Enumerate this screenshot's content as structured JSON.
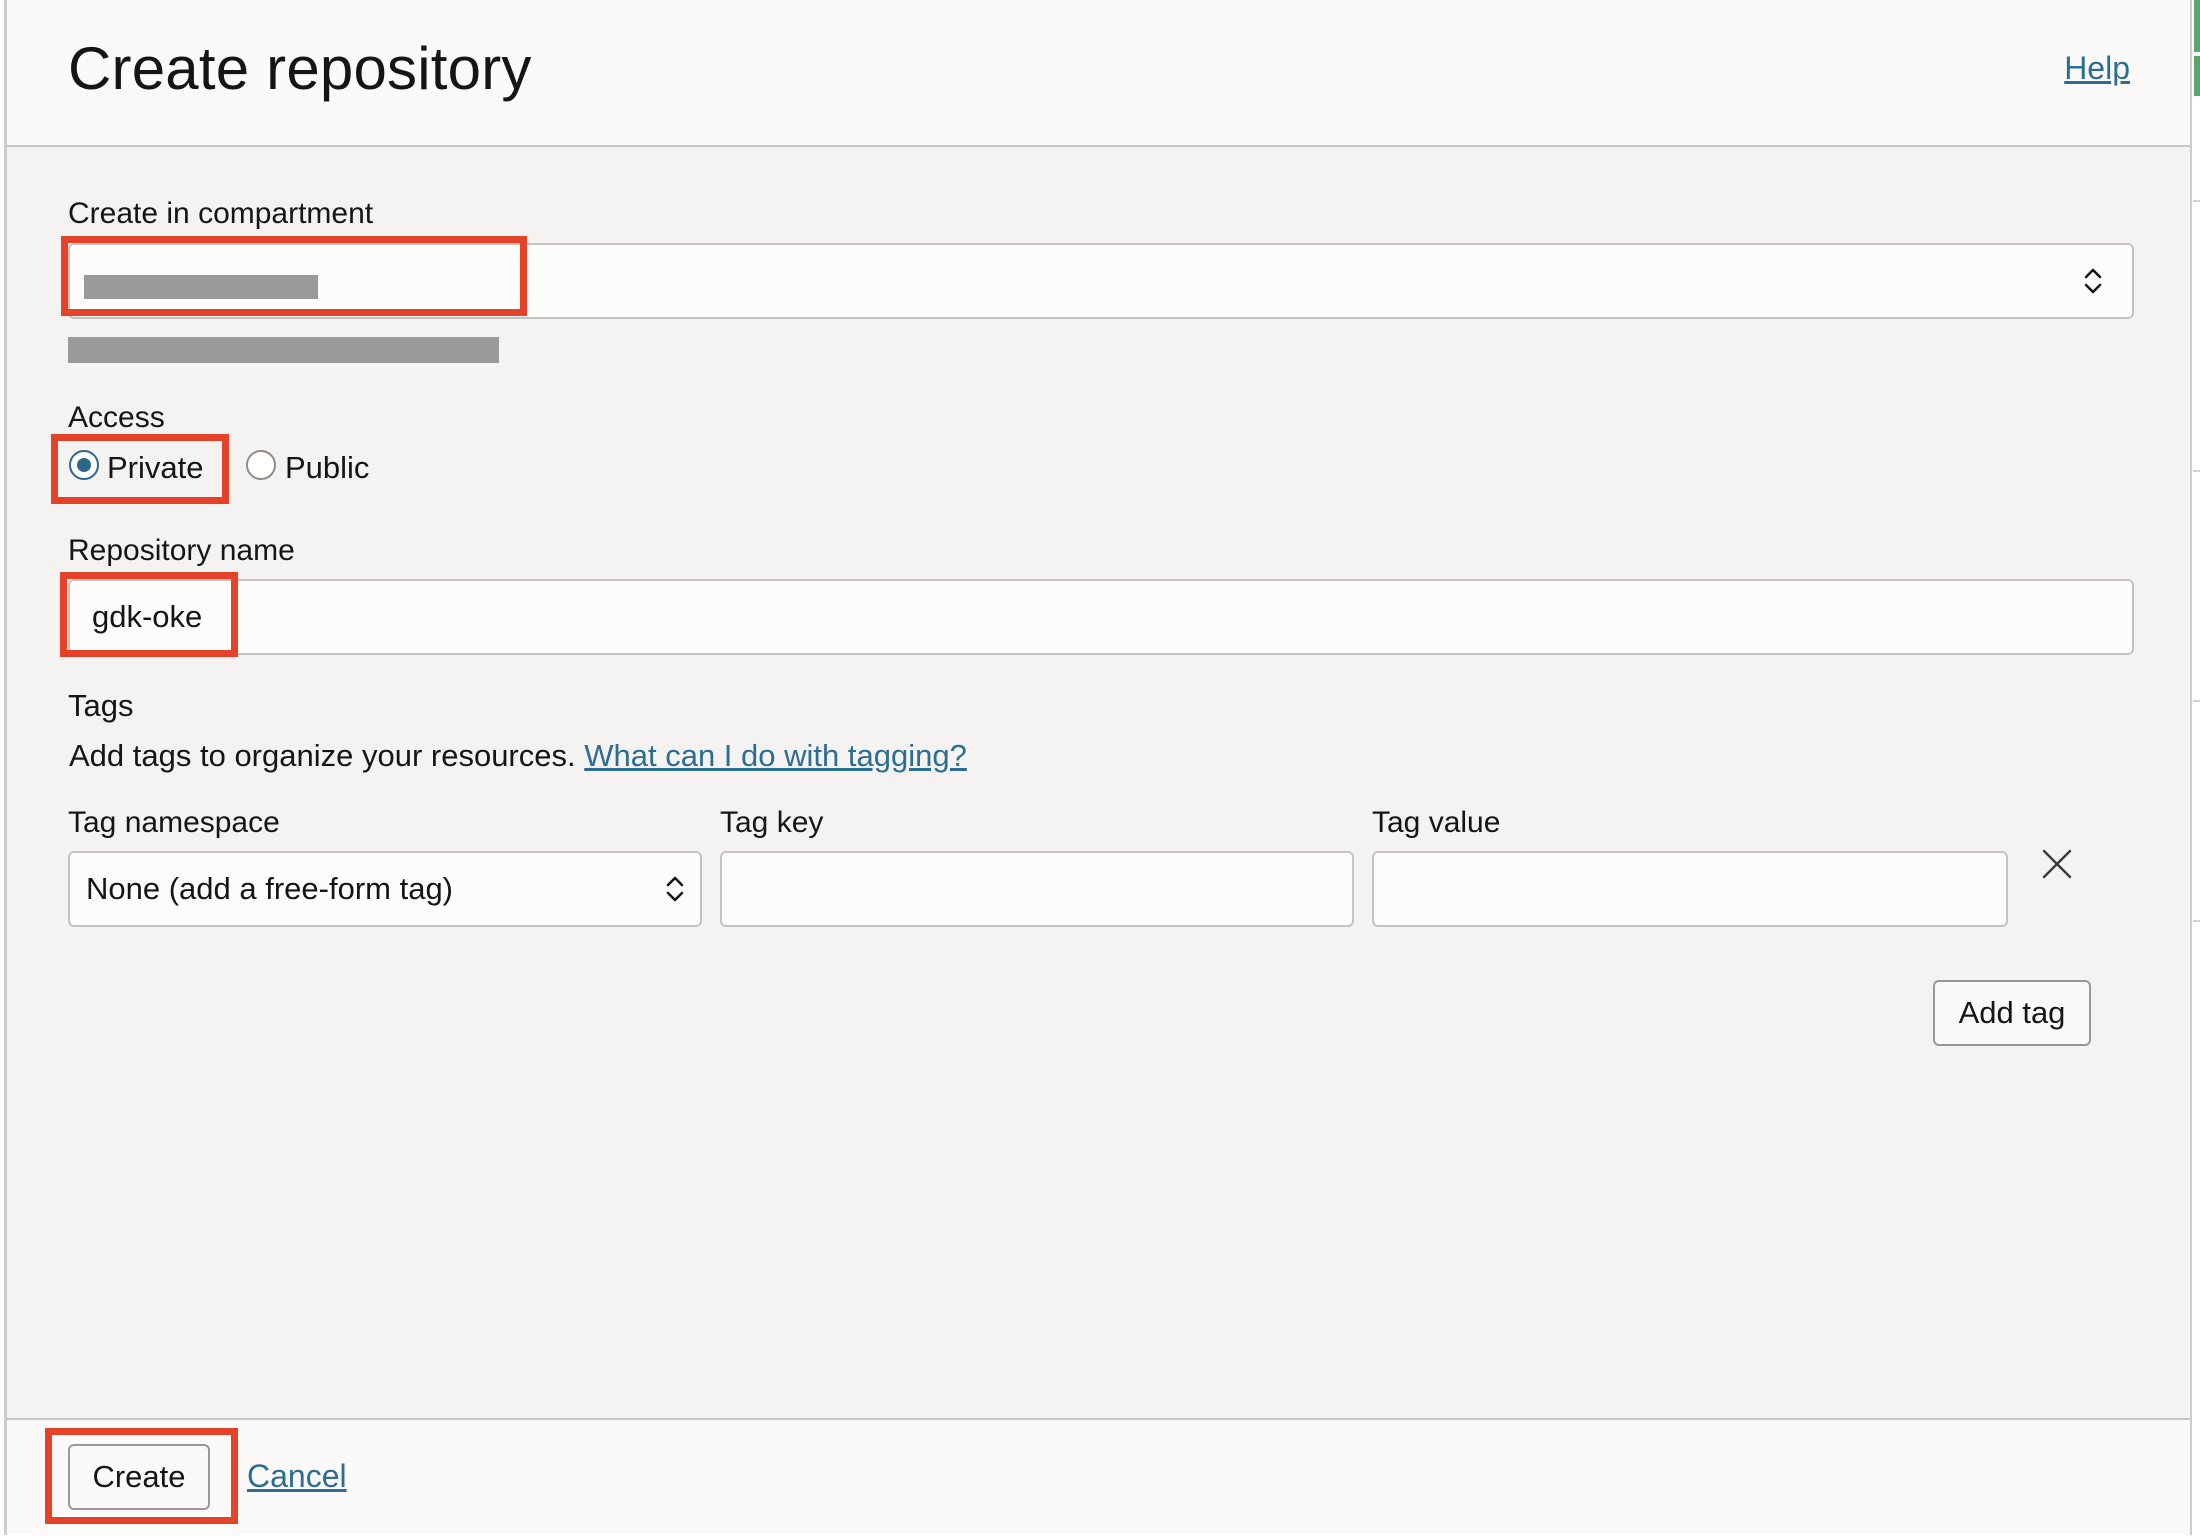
{
  "header": {
    "title": "Create repository",
    "help_link": "Help"
  },
  "compartment": {
    "label": "Create in compartment"
  },
  "access": {
    "label": "Access",
    "options": [
      {
        "label": "Private",
        "selected": true
      },
      {
        "label": "Public",
        "selected": false
      }
    ]
  },
  "repository": {
    "label": "Repository name",
    "value": "gdk-oke"
  },
  "tags": {
    "heading": "Tags",
    "description": "Add tags to organize your resources.",
    "help_link": "What can I do with tagging?",
    "namespace_label": "Tag namespace",
    "namespace_value": "None (add a free-form tag)",
    "key_label": "Tag key",
    "key_value": "",
    "value_label": "Tag value",
    "value_value": "",
    "add_button": "Add tag"
  },
  "footer": {
    "create_button": "Create",
    "cancel_link": "Cancel"
  },
  "colors": {
    "highlight": "#e4432a",
    "link": "#2c6d93",
    "radio_selected": "#2d6789"
  }
}
